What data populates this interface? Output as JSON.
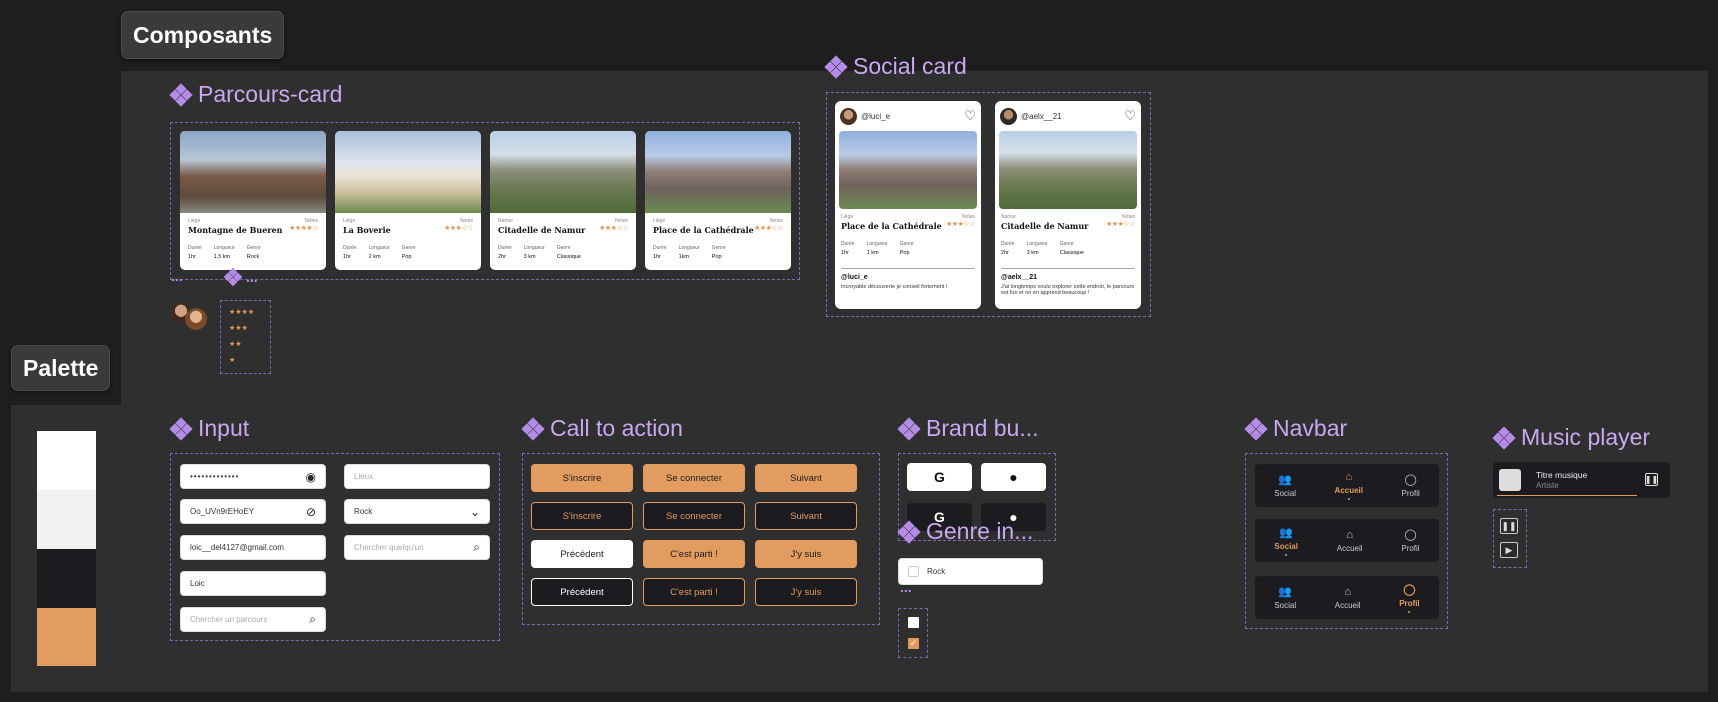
{
  "frames": {
    "composants": "Composants",
    "palette": "Palette"
  },
  "sections": {
    "parcours": "Parcours-card",
    "social": "Social card",
    "input": "Input",
    "cta": "Call to action",
    "brand": "Brand bu...",
    "genre": "Genre in...",
    "navbar": "Navbar",
    "music": "Music player"
  },
  "parcours_cards": [
    {
      "city": "Liège",
      "name": "Montagne de Bueren",
      "stars": "★★★★☆",
      "duree": "1hr",
      "longueur": "1,5 km",
      "genre": "Rock"
    },
    {
      "city": "Liège",
      "name": "La Boverie",
      "stars": "★★★☆☆",
      "duree": "1hr",
      "longueur": "2 km",
      "genre": "Pop"
    },
    {
      "city": "Namur",
      "name": "Citadelle de Namur",
      "stars": "★★★☆☆",
      "duree": "2hr",
      "longueur": "3 km",
      "genre": "Classique"
    },
    {
      "city": "Liège",
      "name": "Place de la Cathédrale",
      "stars": "★★★☆☆",
      "duree": "1hr",
      "longueur": "1km",
      "genre": "Pop"
    }
  ],
  "card_labels": {
    "notes": "Notes",
    "duree": "Durée",
    "longueur": "Longueur",
    "genre": "Genre"
  },
  "ellipsis": "...",
  "rating_variants": [
    "★★★★",
    "★★★",
    "★★",
    "★"
  ],
  "social_cards": [
    {
      "user": "@luci_e",
      "city": "Liège",
      "name": "Place de la Cathédrale",
      "stars": "★★★☆☆",
      "duree": "1hr",
      "longueur": "1 km",
      "genre": "Pop",
      "comment_user": "@luci_e",
      "comment": "Incroyable découverte je conseil fortement !"
    },
    {
      "user": "@aelx__21",
      "city": "Namur",
      "name": "Citadelle de Namur",
      "stars": "★★★☆☆",
      "duree": "2hr",
      "longueur": "3 km",
      "genre": "Classique",
      "comment_user": "@aelx__21",
      "comment": "J'ai longtemps voulu explorer cette endroit, le parcours est fun et on en apprend beaucoup !"
    }
  ],
  "inputs": {
    "password_value": "•••••••••••••",
    "password2_value": "Oo_UVn9rEHoEY",
    "email_value": "loic__del4127@gmail.com",
    "name_value": "Loic",
    "search_parcours_placeholder": "Chercher un parcours",
    "lieux_placeholder": "Lieux",
    "select_value": "Rock",
    "search_user_placeholder": "Chercher quelqu'un"
  },
  "cta": {
    "sinscrire": "S'inscrire",
    "seconnecter": "Se connecter",
    "suivant": "Suivant",
    "precedent": "Précédent",
    "cestparti": "C'est parti !",
    "jysuis": "J'y suis"
  },
  "brand": {
    "google": "G",
    "apple": ""
  },
  "genre": {
    "option": "Rock"
  },
  "navbar": {
    "social": "Social",
    "accueil": "Accueil",
    "profil": "Profil"
  },
  "music": {
    "title": "Titre musique",
    "artist": "Artiste"
  },
  "colors": {
    "white": "#ffffff",
    "light": "#f1f1f1",
    "dark": "#1c1b20",
    "accent": "#e29c60",
    "purple": "#c8a8f0"
  }
}
